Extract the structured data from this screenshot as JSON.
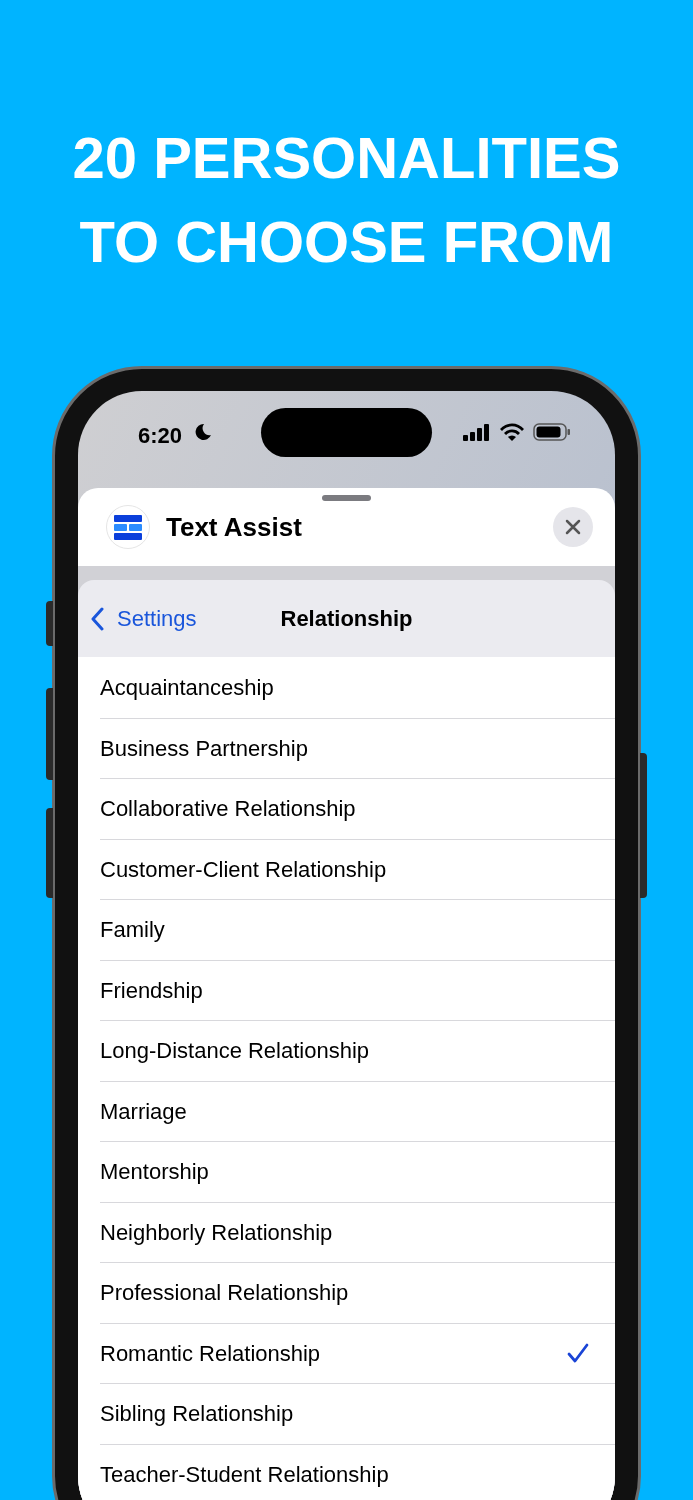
{
  "headline": {
    "lines": [
      "20 PERSONALITIES",
      "TO CHOOSE FROM"
    ]
  },
  "status_bar": {
    "time": "6:20"
  },
  "sheet": {
    "app_title": "Text Assist"
  },
  "nav": {
    "back": "Settings",
    "title": "Relationship"
  },
  "options": [
    {
      "label": "Acquaintanceship",
      "selected": false
    },
    {
      "label": "Business Partnership",
      "selected": false
    },
    {
      "label": "Collaborative Relationship",
      "selected": false
    },
    {
      "label": "Customer-Client Relationship",
      "selected": false
    },
    {
      "label": "Family",
      "selected": false
    },
    {
      "label": "Friendship",
      "selected": false
    },
    {
      "label": "Long-Distance Relationship",
      "selected": false
    },
    {
      "label": "Marriage",
      "selected": false
    },
    {
      "label": "Mentorship",
      "selected": false
    },
    {
      "label": "Neighborly Relationship",
      "selected": false
    },
    {
      "label": "Professional Relationship",
      "selected": false
    },
    {
      "label": "Romantic Relationship",
      "selected": true
    },
    {
      "label": "Sibling Relationship",
      "selected": false
    },
    {
      "label": "Teacher-Student Relationship",
      "selected": false
    }
  ]
}
